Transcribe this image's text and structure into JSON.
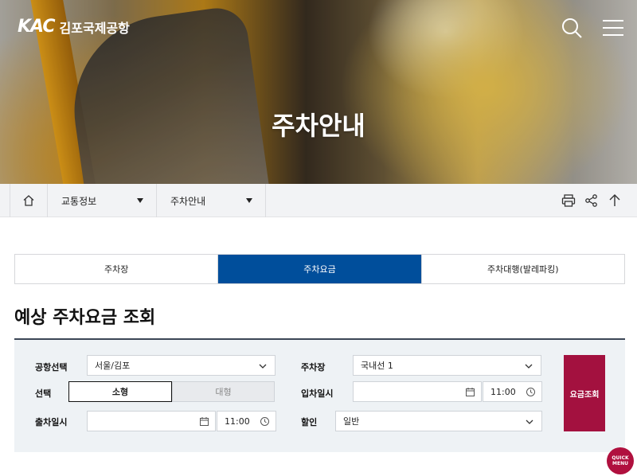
{
  "header": {
    "logo_mark": "KAC",
    "logo_name": "김포국제공항",
    "page_title": "주차안내"
  },
  "breadcrumb": {
    "level1": "교통정보",
    "level2": "주차안내"
  },
  "tabs": [
    {
      "label": "주차장",
      "active": false
    },
    {
      "label": "주차요금",
      "active": true
    },
    {
      "label": "주차대행(발레파킹)",
      "active": false
    }
  ],
  "section_title": "예상 주차요금 조회",
  "form": {
    "airport_label": "공항선택",
    "airport_value": "서울/김포",
    "lot_label": "주차장",
    "lot_value": "국내선 1",
    "type_label": "선택",
    "type_small": "소형",
    "type_large": "대형",
    "entry_label": "입차일시",
    "entry_date": "",
    "entry_time": "11:00",
    "exit_label": "출차일시",
    "exit_date": "",
    "exit_time": "11:00",
    "discount_label": "할인",
    "discount_value": "일반",
    "submit_label": "요금조회"
  },
  "quick_menu": "QUICK MENU",
  "colors": {
    "primary_blue": "#004e9b",
    "accent_red": "#a3113f",
    "panel_bg": "#eef2f5"
  },
  "icons": [
    "search-icon",
    "hamburger-menu-icon",
    "home-icon",
    "print-icon",
    "share-icon",
    "arrow-up-icon",
    "chevron-down-icon",
    "calendar-icon",
    "clock-icon"
  ]
}
